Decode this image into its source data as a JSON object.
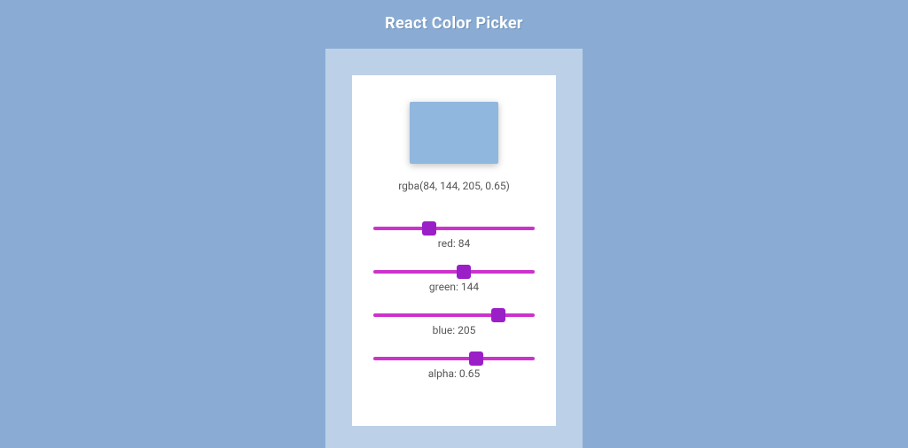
{
  "title": "React Color Picker",
  "color": {
    "red": 84,
    "green": 144,
    "blue": 205,
    "alpha": 0.65,
    "rgba_string": "rgba(84, 144, 205, 0.65)"
  },
  "sliders": {
    "red": {
      "label": "red: 84",
      "min": 0,
      "max": 255,
      "value": 84
    },
    "green": {
      "label": "green: 144",
      "min": 0,
      "max": 255,
      "value": 144
    },
    "blue": {
      "label": "blue: 205",
      "min": 0,
      "max": 255,
      "value": 205
    },
    "alpha": {
      "label": "alpha: 0.65",
      "min": 0,
      "max": 1,
      "step": 0.01,
      "value": 0.65
    }
  },
  "accent_color": "#cc33cc"
}
